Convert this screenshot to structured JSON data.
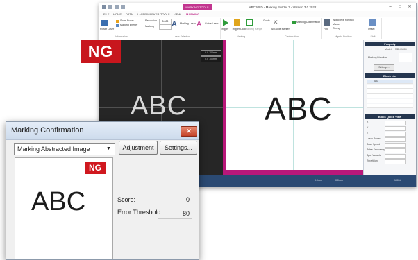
{
  "app": {
    "title": "ABC.MLD - Marking Builder 3 - Version 3.0.2022",
    "context_tab": "MARKING TOOLS",
    "tabs": [
      "FILE",
      "HOME",
      "DATA",
      "LASER MARKER",
      "TOOLS",
      "VIEW",
      "MARKING"
    ],
    "active_tab": "MARKING",
    "ribbon": {
      "groups": [
        {
          "label": "Information",
          "items": [
            "Show Errors",
            "Marking Energy",
            "Power Laser"
          ]
        },
        {
          "label": "Laser Selection",
          "items": [
            "Resolution",
            "Marking",
            "Marking Laser",
            "Guide Laser"
          ]
        },
        {
          "label": "Marking",
          "items": [
            "Trigger",
            "Trigger Lock",
            "Marking Range"
          ]
        },
        {
          "label": "Confirmation",
          "items": [
            "Guide",
            "All Guide Marker",
            "Marking Confirmation"
          ]
        },
        {
          "label": "Align to Position",
          "items": [
            "Find",
            "Workpiece Position",
            "Marker",
            "Timing"
          ]
        },
        {
          "label": "Shift",
          "items": [
            "Offset"
          ]
        }
      ],
      "resolution_value": "0.000"
    },
    "cam_boxes": [
      "0.0 100mm",
      "0.0 100mm"
    ],
    "camera_text": "ABC",
    "layout_text": "ABC",
    "right_panel": {
      "properties_header": "Property",
      "model_label": "Model",
      "model_value": "MD-X1000",
      "marking_direction_label": "Marking Direction",
      "settings_button": "Settings...",
      "block_list_header": "Block List",
      "block_list_first": "ABC",
      "block_quick_view_header": "Block Quick View",
      "fields": [
        "X",
        "Y",
        "Z",
        "Laser Power",
        "Scan Speed",
        "Pulse Frequency",
        "Spot Variable",
        "Repetition"
      ]
    },
    "status_items": [
      "0.0mm",
      "0.0mm",
      "100%"
    ]
  },
  "badge": {
    "ng": "NG"
  },
  "dialog": {
    "title": "Marking Confirmation",
    "mode_select": "Marking Abstracted Image",
    "adjustment_button": "Adjustment",
    "settings_button": "Settings...",
    "ng": "NG",
    "image_text": "ABC",
    "score_label": "Score:",
    "score_value": "0",
    "threshold_label": "Error Threshold:",
    "threshold_value": "80"
  },
  "colors": {
    "ng_red": "#c8161d",
    "magenta_border": "#b8187a",
    "status_blue": "#2b4a73",
    "panel_header": "#25364f"
  }
}
